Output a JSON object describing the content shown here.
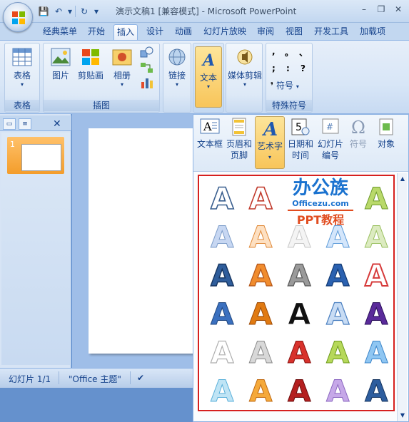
{
  "window": {
    "title": "演示文稿1 [兼容模式] - Microsoft PowerPoint",
    "controls": {
      "minimize": "–",
      "restore": "❐",
      "close": "✕"
    }
  },
  "qat": {
    "save": "💾",
    "undo": "↶",
    "undo_drop": "▾",
    "redo": "↻",
    "customize": "▾"
  },
  "tabs": [
    "经典菜单",
    "开始",
    "插入",
    "设计",
    "动画",
    "幻灯片放映",
    "审阅",
    "视图",
    "开发工具",
    "加载项"
  ],
  "active_tab": "插入",
  "ribbon": {
    "table": {
      "button": "表格",
      "group": "表格"
    },
    "illustrations": {
      "picture": "图片",
      "clipart": "剪贴画",
      "album": "相册",
      "group": "插图"
    },
    "links": {
      "button": "链接"
    },
    "text": {
      "button": "文本"
    },
    "media": {
      "button": "媒体剪辑"
    },
    "symbols": {
      "chars": [
        ",",
        "。",
        "、",
        ";",
        ":",
        "?"
      ],
      "symbol_btn": "符号",
      "group": "特殊符号"
    }
  },
  "dropdown": {
    "buttons": [
      {
        "label": "文本框"
      },
      {
        "label": "页眉和\n页脚"
      },
      {
        "label": "艺术字"
      },
      {
        "label": "日期和\n时间"
      },
      {
        "label": "幻灯片\n编号"
      },
      {
        "label": "符号"
      },
      {
        "label": "对象"
      }
    ],
    "gallery_letter": "A",
    "watermark": {
      "title": "办公族",
      "url": "Officezu.com",
      "subtitle": "PPT教程"
    }
  },
  "leftpanel": {
    "slide_number": "1"
  },
  "statusbar": {
    "slide": "幻灯片 1/1",
    "theme": "\"Office 主题\""
  },
  "colors": {
    "accent_red": "#d6201f",
    "ribbon_text": "#15428b",
    "pressed": "#f8c55a"
  }
}
